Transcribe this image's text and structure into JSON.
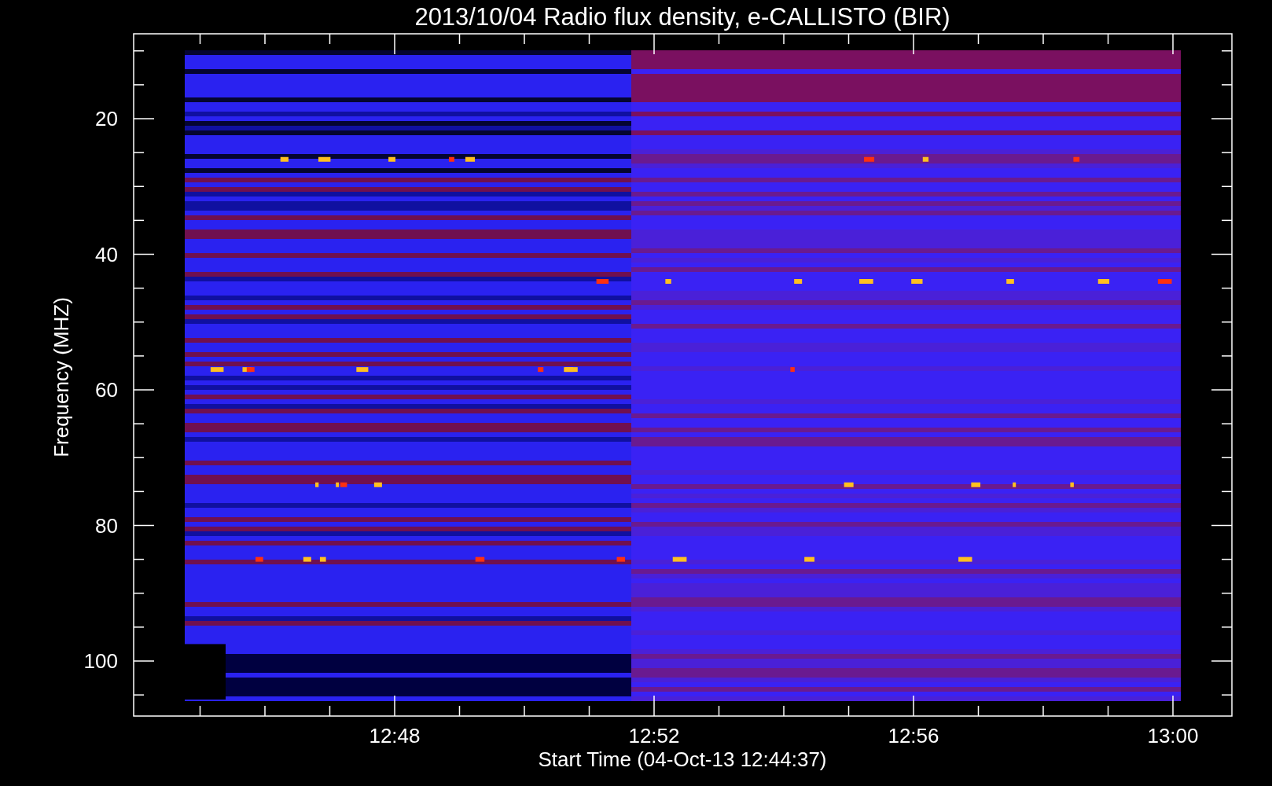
{
  "title": "2013/10/04  Radio flux density, e-CALLISTO (BIR)",
  "ylabel": "Frequency (MHZ)",
  "xlabel": "Start Time (04-Oct-13 12:44:37)",
  "yticks": [
    "20",
    "40",
    "60",
    "80",
    "100"
  ],
  "xticks": [
    "12:48",
    "12:52",
    "12:56",
    "13:00"
  ]
}
